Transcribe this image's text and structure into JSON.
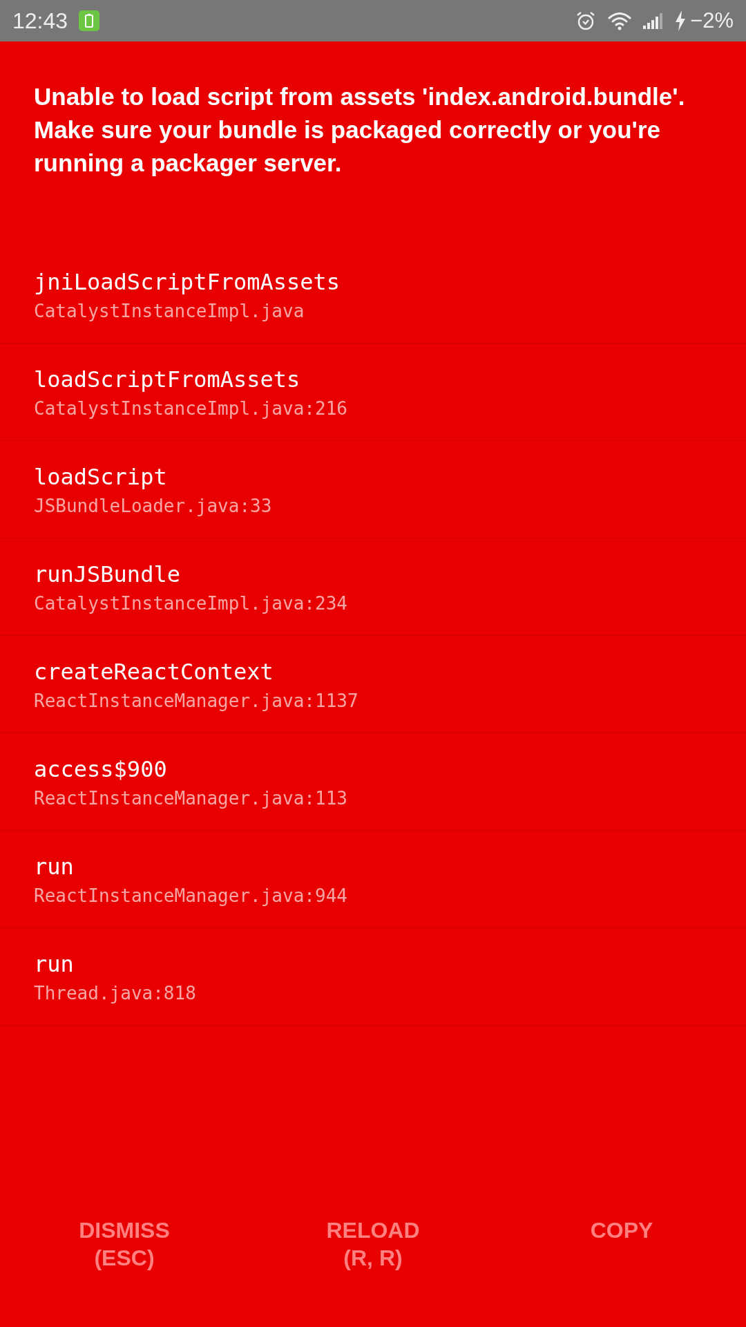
{
  "status_bar": {
    "time": "12:43",
    "battery_text": "−2%"
  },
  "error": {
    "message": "Unable to load script from assets 'index.android.bundle'. Make sure your bundle is packaged correctly or you're running a packager server."
  },
  "stack_frames": [
    {
      "method": "jniLoadScriptFromAssets",
      "file": "CatalystInstanceImpl.java"
    },
    {
      "method": "loadScriptFromAssets",
      "file": "CatalystInstanceImpl.java:216"
    },
    {
      "method": "loadScript",
      "file": "JSBundleLoader.java:33"
    },
    {
      "method": "runJSBundle",
      "file": "CatalystInstanceImpl.java:234"
    },
    {
      "method": "createReactContext",
      "file": "ReactInstanceManager.java:1137"
    },
    {
      "method": "access$900",
      "file": "ReactInstanceManager.java:113"
    },
    {
      "method": "run",
      "file": "ReactInstanceManager.java:944"
    },
    {
      "method": "run",
      "file": "Thread.java:818"
    }
  ],
  "buttons": [
    {
      "label": "DISMISS",
      "shortcut": "(ESC)"
    },
    {
      "label": "RELOAD",
      "shortcut": "(R, R)"
    },
    {
      "label": "COPY"
    }
  ]
}
